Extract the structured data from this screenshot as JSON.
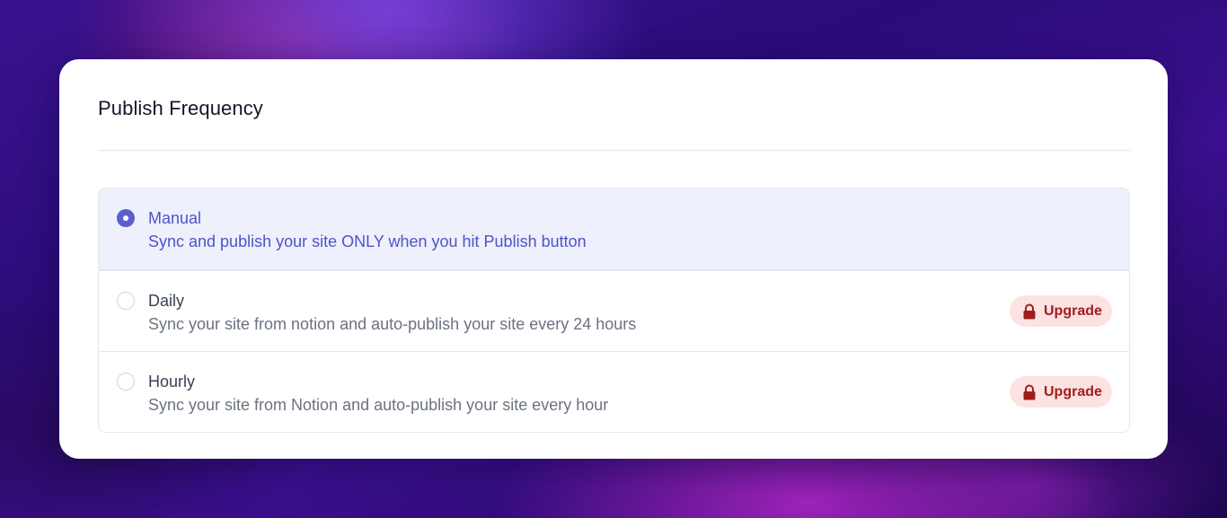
{
  "card": {
    "title": "Publish Frequency"
  },
  "options": [
    {
      "label": "Manual",
      "description": "Sync and publish your site ONLY when you hit Publish button",
      "selected": true
    },
    {
      "label": "Daily",
      "description": "Sync your site from notion and auto-publish your site every 24 hours",
      "selected": false,
      "badge": "Upgrade",
      "badge_icon": "lock-icon"
    },
    {
      "label": "Hourly",
      "description": "Sync your site from Notion and auto-publish your site every hour",
      "selected": false,
      "badge": "Upgrade",
      "badge_icon": "lock-icon"
    }
  ],
  "colors": {
    "accent": "#5a5fcf",
    "selected_bg": "#eef0fc",
    "upgrade_bg": "#fde2e2",
    "upgrade_text": "#a11d1d"
  }
}
